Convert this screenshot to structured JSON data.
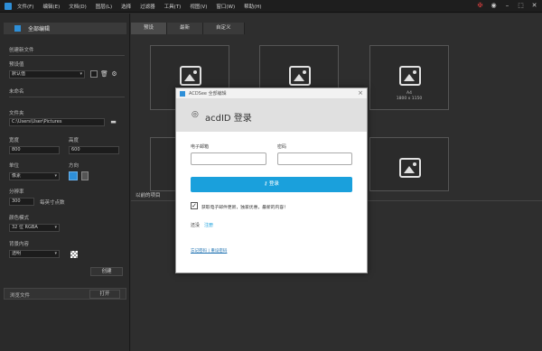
{
  "menubar": {
    "items": [
      "文件(F)",
      "编辑(E)",
      "文档(D)",
      "图层(L)",
      "选择",
      "过滤器",
      "工具(T)",
      "视图(V)",
      "窗口(W)",
      "帮助(H)"
    ]
  },
  "left": {
    "header_title": "全部编辑",
    "section_create": "创建新文件",
    "preset_label": "预设值",
    "preset_value": "默认值",
    "unnamed": "未命名",
    "folder_label": "文件夹",
    "folder_value": "C:\\Users\\User\\Pictures",
    "width_label": "宽度",
    "width_value": "800",
    "height_label": "高度",
    "height_value": "600",
    "unit_label": "单位",
    "unit_value": "像素",
    "orientation_label": "方向",
    "resolution_label": "分辨率",
    "resolution_value": "300",
    "resolution_unit": "每英寸点数",
    "color_mode_label": "颜色模式",
    "color_mode_value": "32 位 RGBA",
    "background_label": "背景内容",
    "background_value": "透明",
    "create_button": "创建",
    "browse_label": "浏览文件",
    "open_button": "打开"
  },
  "main": {
    "tabs": [
      "预设",
      "最新",
      "自定义"
    ],
    "template_caption_name": "A4",
    "template_caption_size": "1800 x 1150",
    "recent_label": "以前的项目"
  },
  "dialog": {
    "title": "ACDSee 全部编辑",
    "brand": "acdID 登录",
    "email_label": "电子邮箱",
    "password_label": "密码",
    "signin_label": "登录",
    "remember_label": "获取电子邮件更新，独家优惠，最新的内容！",
    "remember_checked": true,
    "no_account": "还没",
    "register_link": "注册",
    "forgot_links": "忘记密码 | 重设密码"
  }
}
